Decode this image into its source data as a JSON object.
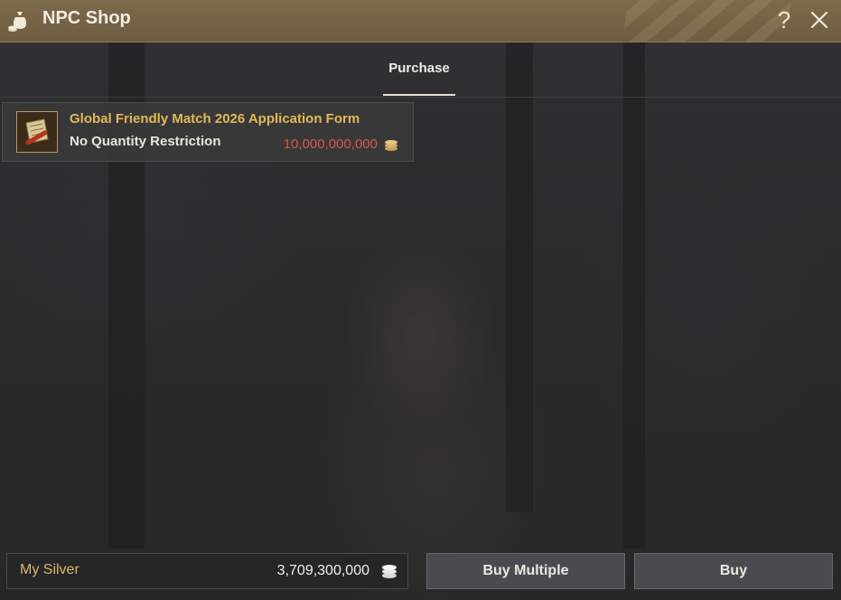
{
  "window": {
    "title": "NPC Shop"
  },
  "tabs": [
    {
      "label": "Purchase",
      "active": true
    }
  ],
  "items": [
    {
      "name": "Global Friendly Match 2026 Application Form",
      "restriction": "No Quantity Restriction",
      "price": "10,000,000,000",
      "currency_icon": "silver-coin-icon"
    }
  ],
  "footer": {
    "silver_label": "My Silver",
    "silver_value": "3,709,300,000",
    "buy_multiple_label": "Buy Multiple",
    "buy_label": "Buy"
  },
  "colors": {
    "title_bar": "#7c6a4c",
    "item_name": "#e2b858",
    "price": "#d9584a",
    "silver_label": "#d9b76a"
  }
}
